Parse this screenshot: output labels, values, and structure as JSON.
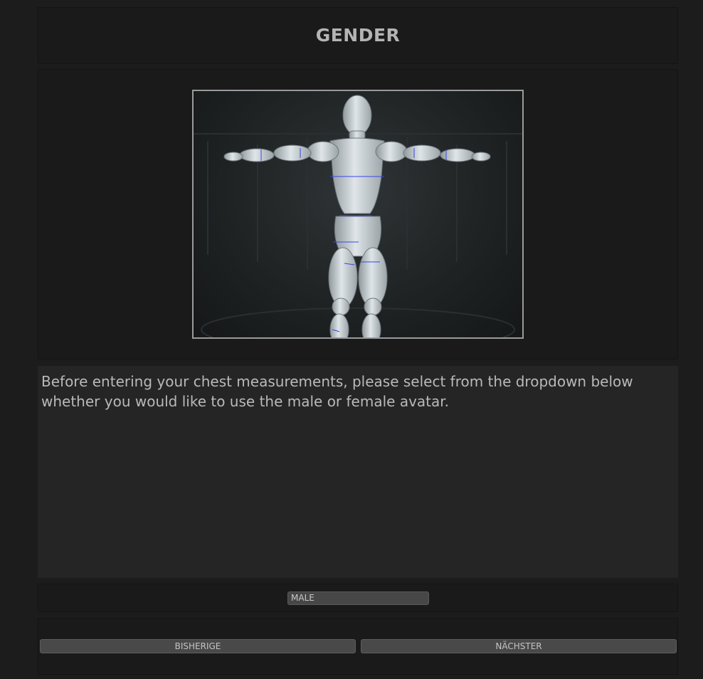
{
  "header": {
    "title": "GENDER"
  },
  "preview": {
    "image_description_icon": "avatar-3d-model-icon"
  },
  "content": {
    "instructions": "Before entering your chest measurements, please select from the dropdown below whether you would like to use the male or female avatar."
  },
  "gender_select": {
    "selected": "MALE"
  },
  "navigation": {
    "previous_label": "BISHERIGE",
    "next_label": "NÄCHSTER"
  },
  "colors": {
    "background": "#1c1c1c",
    "panel": "#1a1a1a",
    "text_panel": "#252525",
    "button": "#494949",
    "title_text": "#b4b4b4"
  }
}
